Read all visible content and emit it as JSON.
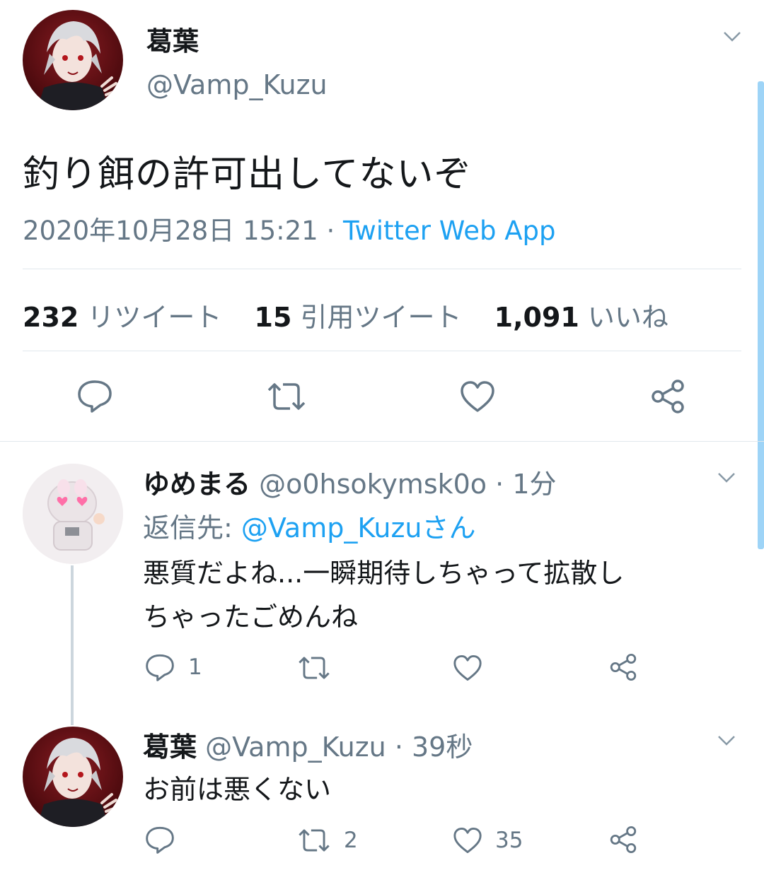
{
  "tweet": {
    "display_name": "葛葉",
    "handle": "@Vamp_Kuzu",
    "text": "釣り餌の許可出してないぞ",
    "date": "2020年10月28日 15:21",
    "separator": "·",
    "source": "Twitter Web App",
    "stats": {
      "retweets_count": "232",
      "retweets_label": "リツイート",
      "quotes_count": "15",
      "quotes_label": "引用ツイート",
      "likes_count": "1,091",
      "likes_label": "いいね"
    }
  },
  "replies": [
    {
      "display_name": "ゆめまる",
      "handle": "@o0hsokymsk0o",
      "separator": "·",
      "time": "1分",
      "reply_to_prefix": "返信先: ",
      "reply_to_handle": "@Vamp_Kuzu",
      "reply_to_suffix": "さん",
      "text_line1": "悪質だよね...一瞬期待しちゃって拡散し",
      "text_line2": "ちゃったごめんね",
      "reply_count": "1",
      "retweet_count": "",
      "like_count": ""
    },
    {
      "display_name": "葛葉",
      "handle": "@Vamp_Kuzu",
      "separator": "·",
      "time": "39秒",
      "text": "お前は悪くない",
      "reply_count": "",
      "retweet_count": "2",
      "like_count": "35"
    }
  ],
  "icons": [
    "reply-icon",
    "retweet-icon",
    "like-icon",
    "share-icon",
    "chevron-down-icon"
  ],
  "colors": {
    "accent": "#1da1f2",
    "muted": "#657786",
    "text": "#14171a",
    "divider": "#e1e8ed"
  }
}
